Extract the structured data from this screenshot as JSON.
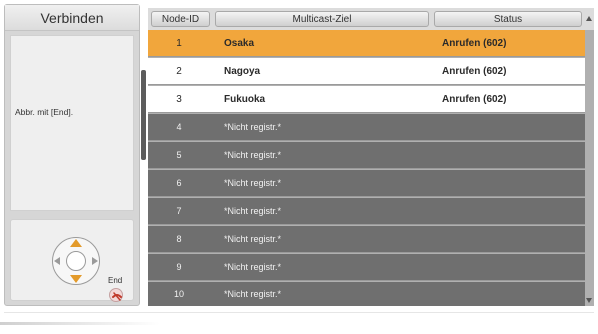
{
  "left_panel": {
    "title": "Verbinden",
    "message": "Abbr. mit [End].",
    "end_label": "End"
  },
  "table": {
    "headers": {
      "node_id": "Node-ID",
      "multicast_target": "Multicast-Ziel",
      "status": "Status"
    },
    "rows": [
      {
        "id": "1",
        "target": "Osaka",
        "status": "Anrufen (602)",
        "state": "selected"
      },
      {
        "id": "2",
        "target": "Nagoya",
        "status": "Anrufen (602)",
        "state": "registered"
      },
      {
        "id": "3",
        "target": "Fukuoka",
        "status": "Anrufen (602)",
        "state": "registered"
      },
      {
        "id": "4",
        "target": "*Nicht registr.*",
        "status": "",
        "state": "unregistered"
      },
      {
        "id": "5",
        "target": "*Nicht registr.*",
        "status": "",
        "state": "unregistered"
      },
      {
        "id": "6",
        "target": "*Nicht registr.*",
        "status": "",
        "state": "unregistered"
      },
      {
        "id": "7",
        "target": "*Nicht registr.*",
        "status": "",
        "state": "unregistered"
      },
      {
        "id": "8",
        "target": "*Nicht registr.*",
        "status": "",
        "state": "unregistered"
      },
      {
        "id": "9",
        "target": "*Nicht registr.*",
        "status": "",
        "state": "unregistered"
      },
      {
        "id": "10",
        "target": "*Nicht registr.*",
        "status": "",
        "state": "unregistered"
      }
    ]
  },
  "colors": {
    "selected_row": "#f1a63c",
    "registered_row": "#ffffff",
    "unregistered_row": "#6f6f6f",
    "dpad_arrow_accent": "#e39a2a"
  },
  "icons": [
    "dpad-icon",
    "end-call-icon",
    "scroll-up-arrow-icon",
    "scroll-down-arrow-icon"
  ]
}
